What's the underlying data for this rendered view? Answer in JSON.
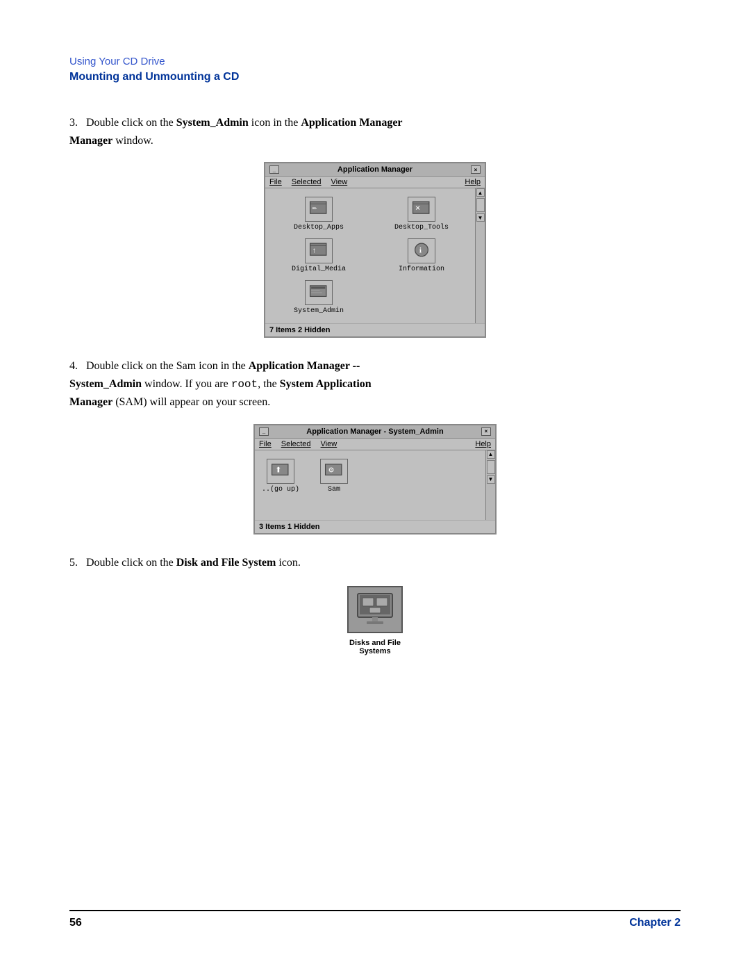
{
  "breadcrumb": {
    "link_text": "Using Your CD Drive",
    "title": "Mounting and Unmounting a CD"
  },
  "steps": [
    {
      "number": "3.",
      "text_before": "Double click on the ",
      "bold1": "System_Admin",
      "text_mid1": " icon in the ",
      "bold2": "Application Manager",
      "text_after": " window."
    },
    {
      "number": "4.",
      "text_before": "Double click on the Sam icon in the ",
      "bold1": "Application Manager --",
      "text_line2_bold": "System_Admin",
      "text_line2_after": " window. If you are ",
      "mono1": "root",
      "text_mid": ", the ",
      "bold2": "System Application",
      "text_end_bold": "Manager",
      "text_end": " (SAM) will appear on your screen."
    },
    {
      "number": "5.",
      "text_before": "Double click on the ",
      "bold1": "Disk and File System",
      "text_after": " icon."
    }
  ],
  "window1": {
    "title": "Application Manager",
    "menus": [
      "File",
      "Selected",
      "View",
      "Help"
    ],
    "icons": [
      {
        "label": "Desktop_Apps"
      },
      {
        "label": "Desktop_Tools"
      },
      {
        "label": "Digital_Media"
      },
      {
        "label": "Information"
      },
      {
        "label": "System_Admin"
      }
    ],
    "status": "7 Items 2 Hidden"
  },
  "window2": {
    "title": "Application Manager - System_Admin",
    "menus": [
      "File",
      "Selected",
      "View",
      "Help"
    ],
    "icons": [
      {
        "label": "..(go up)"
      },
      {
        "label": "Sam"
      }
    ],
    "status": "3 Items 1 Hidden"
  },
  "disk_icon": {
    "label_line1": "Disks and File",
    "label_line2": "Systems"
  },
  "footer": {
    "page_number": "56",
    "chapter_label": "Chapter 2"
  }
}
